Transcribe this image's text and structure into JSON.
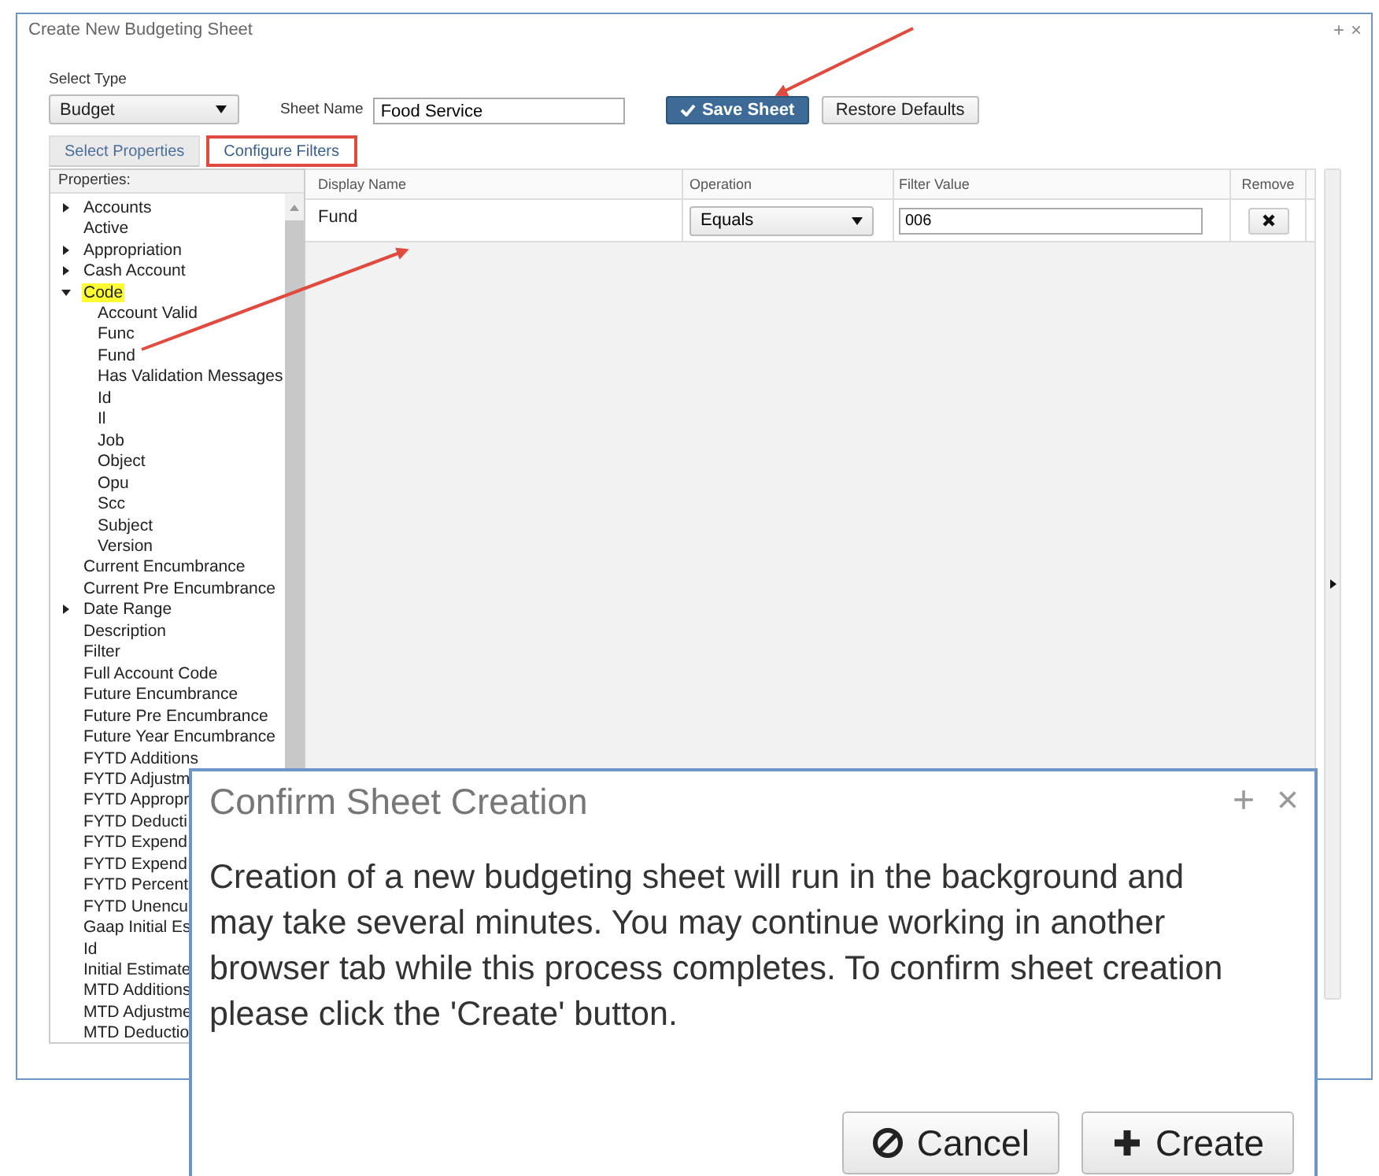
{
  "window": {
    "title": "Create New Budgeting Sheet",
    "controls": [
      "+",
      "×"
    ]
  },
  "select_type": {
    "label": "Select Type",
    "value": "Budget"
  },
  "sheet_name": {
    "label": "Sheet Name",
    "value": "Food Service"
  },
  "buttons": [
    {
      "label": "Save Sheet",
      "kind": "primary"
    },
    {
      "label": "Restore Defaults",
      "kind": "default"
    }
  ],
  "tabs": [
    {
      "label": "Select Properties",
      "selected": false,
      "highlighted": false
    },
    {
      "label": "Configure Filters",
      "selected": true,
      "highlighted": true
    }
  ],
  "properties": {
    "header": "Properties:",
    "items": [
      {
        "label": "Accounts",
        "expanded": false,
        "selected": false
      },
      {
        "label": "Active",
        "selected": false
      },
      {
        "label": "Appropriation",
        "expanded": false,
        "selected": false
      },
      {
        "label": "Cash Account",
        "expanded": false,
        "selected": false
      },
      {
        "label": "Code",
        "expanded": true,
        "selected": true,
        "children": [
          {
            "label": "Account Valid",
            "selected": false
          },
          {
            "label": "Func",
            "selected": false
          },
          {
            "label": "Fund",
            "selected": false
          },
          {
            "label": "Has Validation Messages",
            "selected": false
          },
          {
            "label": "Id",
            "selected": false
          },
          {
            "label": "Il",
            "selected": false
          },
          {
            "label": "Job",
            "selected": false
          },
          {
            "label": "Object",
            "selected": false
          },
          {
            "label": "Opu",
            "selected": false
          },
          {
            "label": "Scc",
            "selected": false
          },
          {
            "label": "Subject",
            "selected": false
          },
          {
            "label": "Version",
            "selected": false
          }
        ]
      },
      {
        "label": "Current Encumbrance",
        "selected": false
      },
      {
        "label": "Current Pre Encumbrance",
        "selected": false
      },
      {
        "label": "Date Range",
        "expanded": false,
        "selected": false
      },
      {
        "label": "Description",
        "selected": false
      },
      {
        "label": "Filter",
        "selected": false
      },
      {
        "label": "Full Account Code",
        "selected": false
      },
      {
        "label": "Future Encumbrance",
        "selected": false
      },
      {
        "label": "Future Pre Encumbrance",
        "selected": false
      },
      {
        "label": "Future Year Encumbrance",
        "selected": false
      },
      {
        "label": "FYTD Additions",
        "selected": false
      },
      {
        "label": "FYTD Adjustm",
        "selected": false
      },
      {
        "label": "FYTD Appropr",
        "selected": false
      },
      {
        "label": "FYTD Deducti",
        "selected": false
      },
      {
        "label": "FYTD Expend",
        "selected": false
      },
      {
        "label": "FYTD Expend",
        "selected": false
      },
      {
        "label": "FYTD Percent",
        "selected": false
      },
      {
        "label": "FYTD Unencu",
        "selected": false
      },
      {
        "label": "Gaap Initial Es",
        "selected": false
      },
      {
        "label": "Id",
        "selected": false
      },
      {
        "label": "Initial Estimate",
        "selected": false
      },
      {
        "label": "MTD Additions",
        "selected": false
      },
      {
        "label": "MTD Adjustme",
        "selected": false
      },
      {
        "label": "MTD Deductio",
        "selected": false
      }
    ]
  },
  "filters": {
    "columns": [
      "Display Name",
      "Operation",
      "Filter Value",
      "Remove"
    ],
    "rows": [
      {
        "display_name": "Fund",
        "operation": "Equals",
        "filter_value": "006"
      }
    ]
  },
  "dialog": {
    "title": "Confirm Sheet Creation",
    "controls": [
      "+",
      "×"
    ],
    "message": "Creation of a new budgeting sheet will run in the background and may take several minutes. You may continue working in another browser tab while this process completes. To confirm sheet creation please click the 'Create' button.",
    "buttons": [
      {
        "label": "Cancel",
        "kind": "cancel"
      },
      {
        "label": "Create",
        "kind": "create"
      }
    ]
  }
}
